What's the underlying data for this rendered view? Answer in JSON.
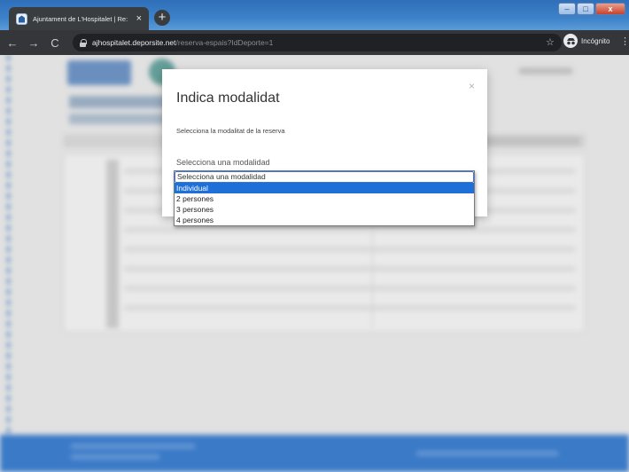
{
  "browser": {
    "tab_title": "Ajuntament de L'Hospitalet | Re:",
    "tab_close": "×",
    "new_tab": "+",
    "url_host": "ajhospitalet.deporsite.net",
    "url_path": "/reserva-espais?IdDeporte=1",
    "profile_label": "Incógnito"
  },
  "modal": {
    "title": "Indica modalidat",
    "close": "×",
    "subtitle": "Selecciona la modalitat de la reserva",
    "field_label": "Selecciona una modalidad"
  },
  "dropdown": {
    "selected": "Selecciona una modalidad",
    "options": [
      "Individual",
      "2 persones",
      "3 persones",
      "4 persones"
    ],
    "highlighted_index": 0
  },
  "colors": {
    "highlight": "#1f6fd8",
    "footer": "#3d7fd0"
  }
}
